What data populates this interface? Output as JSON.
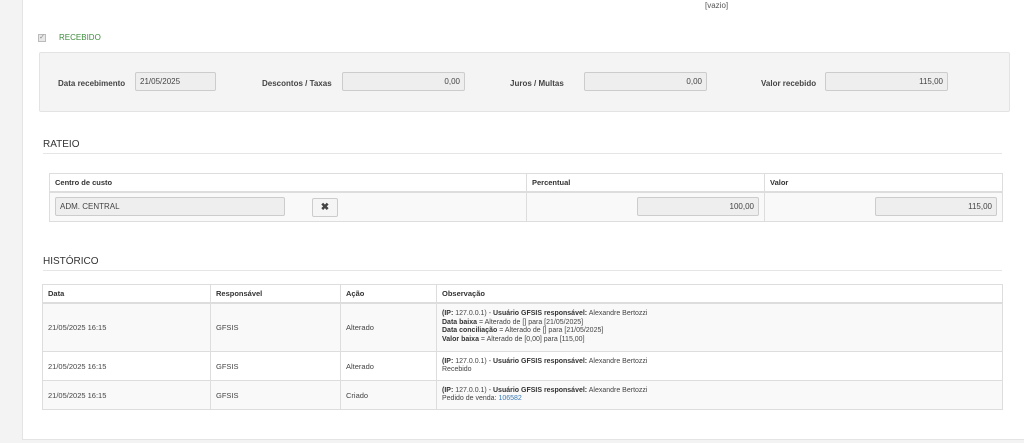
{
  "top_value": "[vazio]",
  "recebido": {
    "label": "RECEBIDO",
    "checked": true
  },
  "payment": {
    "data_recebimento_label": "Data recebimento",
    "data_recebimento_value": "21/05/2025",
    "descontos_label": "Descontos / Taxas",
    "descontos_value": "0,00",
    "juros_label": "Juros / Multas",
    "juros_value": "0,00",
    "valor_recebido_label": "Valor recebido",
    "valor_recebido_value": "115,00"
  },
  "rateio": {
    "title": "RATEIO",
    "headers": [
      "Centro de custo",
      "Percentual",
      "Valor"
    ],
    "row": {
      "centro": "ADM. CENTRAL",
      "percentual": "100,00",
      "valor": "115,00"
    }
  },
  "historico": {
    "title": "HISTÓRICO",
    "headers": [
      "Data",
      "Responsável",
      "Ação",
      "Observação"
    ],
    "rows": [
      {
        "data": "21/05/2025 16:15",
        "responsavel": "GFSIS",
        "acao": "Alterado",
        "obs": {
          "ip_label": "(IP:",
          "ip_value": "127.0.0.1) -",
          "user_label": "Usuário GFSIS responsável:",
          "user_value": "Alexandre Bertozzi",
          "l2_label": "Data baixa",
          "l2_value": "= Alterado de [] para [21/05/2025]",
          "l3_label": "Data conciliação",
          "l3_value": "= Alterado de [] para [21/05/2025]",
          "l4_label": "Valor baixa",
          "l4_value": "= Alterado de [0,00] para [115,00]"
        }
      },
      {
        "data": "21/05/2025 16:15",
        "responsavel": "GFSIS",
        "acao": "Alterado",
        "obs": {
          "ip_label": "(IP:",
          "ip_value": "127.0.0.1) -",
          "user_label": "Usuário GFSIS responsável:",
          "user_value": "Alexandre Bertozzi",
          "l2_text": "Recebido"
        }
      },
      {
        "data": "21/05/2025 16:15",
        "responsavel": "GFSIS",
        "acao": "Criado",
        "obs": {
          "ip_label": "(IP:",
          "ip_value": "127.0.0.1) -",
          "user_label": "Usuário GFSIS responsável:",
          "user_value": "Alexandre Bertozzi",
          "pedido_label": "Pedido de venda:",
          "pedido_link": "106582"
        }
      }
    ]
  }
}
